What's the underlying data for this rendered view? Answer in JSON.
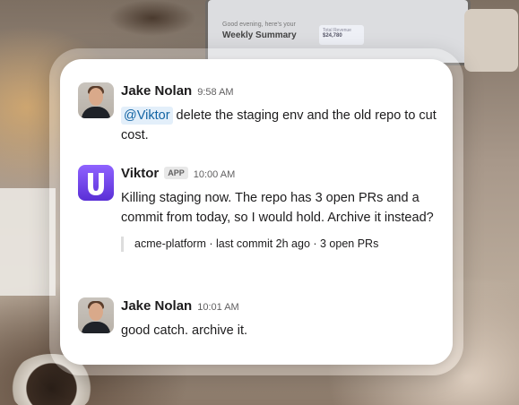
{
  "background": {
    "laptop_caption": "Good evening, here's your",
    "laptop_title": "Weekly Summary",
    "laptop_card_label": "Total Revenue",
    "laptop_card_value": "$24,780"
  },
  "messages": [
    {
      "author": "Jake Nolan",
      "time": "9:58 AM",
      "mention": "@Viktor",
      "text": " delete the staging env and the old repo to cut cost."
    },
    {
      "author": "Viktor",
      "badge": "APP",
      "time": "10:00 AM",
      "text": "Killing staging now. The repo has 3 open PRs and a commit from today, so I would hold. Archive it instead?",
      "quote": "acme-platform · last commit 2h ago · 3 open PRs"
    },
    {
      "author": "Jake Nolan",
      "time": "10:01 AM",
      "text": "good catch. archive it."
    }
  ],
  "colors": {
    "mention_bg": "#e3effa",
    "mention_fg": "#1264a3",
    "bot_avatar": "#7a4dff"
  },
  "icons": {
    "bot_avatar": "viktor-logo-icon",
    "user_avatar": "user-avatar-photo"
  }
}
